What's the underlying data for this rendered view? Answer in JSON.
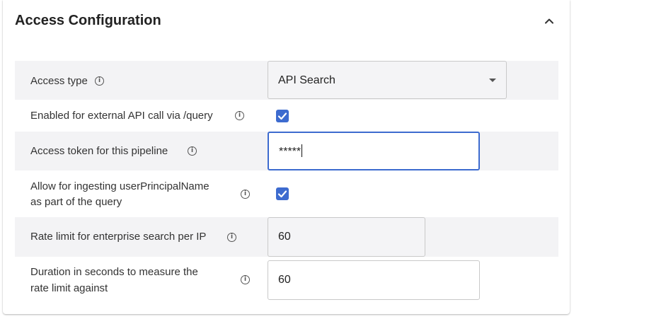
{
  "section": {
    "title": "Access Configuration",
    "collapse_icon": "chevron-up-icon"
  },
  "fields": {
    "access_type": {
      "label": "Access type",
      "value": "API Search"
    },
    "external_api": {
      "label": "Enabled for external API call via /query",
      "checked": true
    },
    "access_token": {
      "label": "Access token for this pipeline",
      "value": "*****"
    },
    "user_principal": {
      "label_line1": "Allow for ingesting userPrincipalName",
      "label_line2": "as part of the query",
      "checked": true
    },
    "rate_limit": {
      "label": "Rate limit for enterprise search per IP",
      "value": "60"
    },
    "duration": {
      "label_line1": "Duration in seconds to measure the",
      "label_line2": "rate limit against",
      "value": "60"
    }
  },
  "colors": {
    "accent": "#3d6bcf",
    "row_shade": "#f3f3f5"
  }
}
